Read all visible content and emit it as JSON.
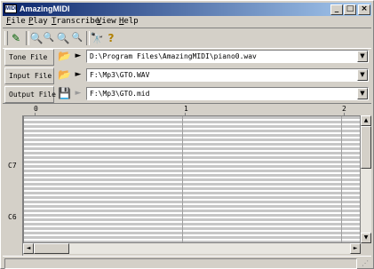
{
  "window": {
    "title": "AmazingMIDI",
    "icon": "app-icon",
    "icon_text": "MIDI",
    "controls": {
      "minimize": "_",
      "maximize": "□",
      "close": "×"
    }
  },
  "menu": [
    {
      "label": "File",
      "accel": "F",
      "rest": "ile"
    },
    {
      "label": "Play",
      "accel": "P",
      "rest": "lay"
    },
    {
      "label": "Transcribe",
      "accel": "T",
      "rest": "ranscribe"
    },
    {
      "label": "View",
      "accel": "V",
      "rest": "iew"
    },
    {
      "label": "Help",
      "accel": "H",
      "rest": "elp"
    }
  ],
  "toolbar": {
    "icons": [
      {
        "name": "transcribe-icon",
        "glyph": "✎"
      },
      {
        "name": "zoom-in-icon",
        "glyph": "🔍"
      },
      {
        "name": "zoom-out-icon",
        "glyph": "🔍"
      },
      {
        "name": "zoom-vertical-icon",
        "glyph": "🔍"
      },
      {
        "name": "zoom-reset-icon",
        "glyph": "🔍"
      },
      {
        "name": "find-icon",
        "glyph": "🔭"
      },
      {
        "name": "help-icon",
        "glyph": "?"
      }
    ]
  },
  "files": {
    "tone": {
      "label": "Tone File",
      "value": "D:\\Program Files\\AmazingMIDI\\piano0.wav",
      "icon": "open-folder-icon",
      "icon_glyph": "📂",
      "play": "►"
    },
    "input": {
      "label": "Input File",
      "value": "F:\\Mp3\\GTO.WAV",
      "icon": "open-folder-icon",
      "icon_glyph": "📂",
      "play": "►"
    },
    "output": {
      "label": "Output File",
      "value": "F:\\Mp3\\GTO.mid",
      "icon": "save-icon",
      "icon_glyph": "💾",
      "play": "►"
    },
    "dropdown_glyph": "▼"
  },
  "ruler": {
    "labels": [
      "0",
      "1",
      "2"
    ]
  },
  "keys": {
    "labels": [
      "C7",
      "C6"
    ]
  },
  "scrollbars": {
    "up": "▲",
    "down": "▼",
    "left": "◄",
    "right": "►"
  },
  "status": {
    "grip_glyph": "⋰"
  },
  "colors": {
    "title_start": "#0a246a",
    "title_end": "#a6caf0",
    "face": "#d4d0c8"
  }
}
